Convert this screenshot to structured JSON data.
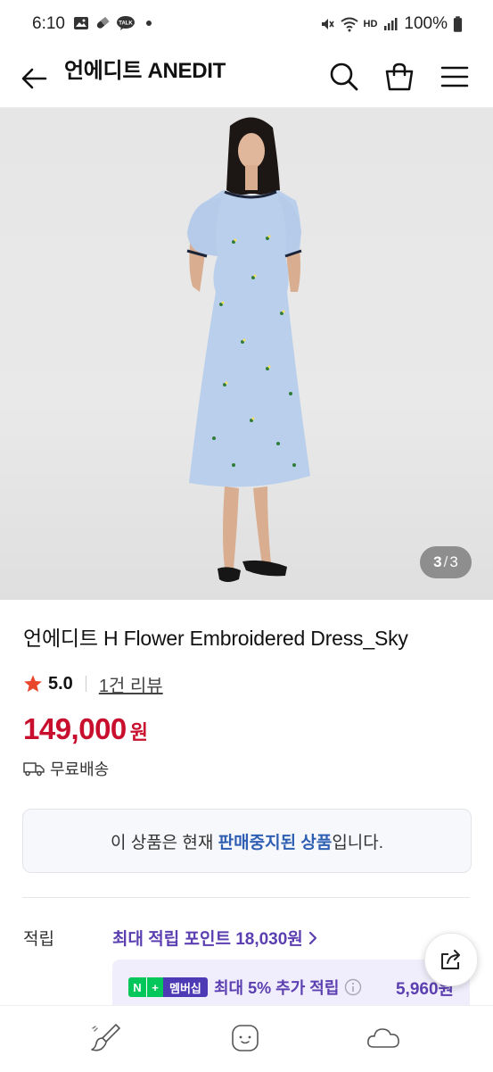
{
  "status_bar": {
    "time": "6:10",
    "talk_badge": "TALK",
    "network_label": "HD",
    "battery": "100%"
  },
  "header": {
    "title": "언에디트 ANEDIT",
    "back_icon": "arrow-left-icon",
    "search_icon": "search-icon",
    "cart_icon": "shopping-bag-icon",
    "menu_icon": "hamburger-menu-icon"
  },
  "gallery": {
    "current": "3",
    "separator": "/",
    "total": "3"
  },
  "product": {
    "name": "언에디트 H Flower Embroidered Dress_Sky",
    "rating": "5.0",
    "review_link": "1건 리뷰",
    "price": "149,000",
    "currency": "원",
    "shipping": "무료배송"
  },
  "notice": {
    "prefix": "이 상품은 현재 ",
    "highlight": "판매중지된 상품",
    "suffix": "입니다."
  },
  "points": {
    "label": "적립",
    "link": "최대 적립 포인트 18,030원",
    "membership": {
      "badge_n": "N",
      "badge_plus": "+",
      "badge_label": "멤버십",
      "text": "최대 5% 추가 적립",
      "amount": "5,960원"
    }
  },
  "colors": {
    "price": "#c8102e",
    "accent_purple": "#5b3fb0",
    "notice_highlight": "#2f5fb3",
    "npay_green": "#03c75a",
    "rating_star": "#e8472b"
  }
}
